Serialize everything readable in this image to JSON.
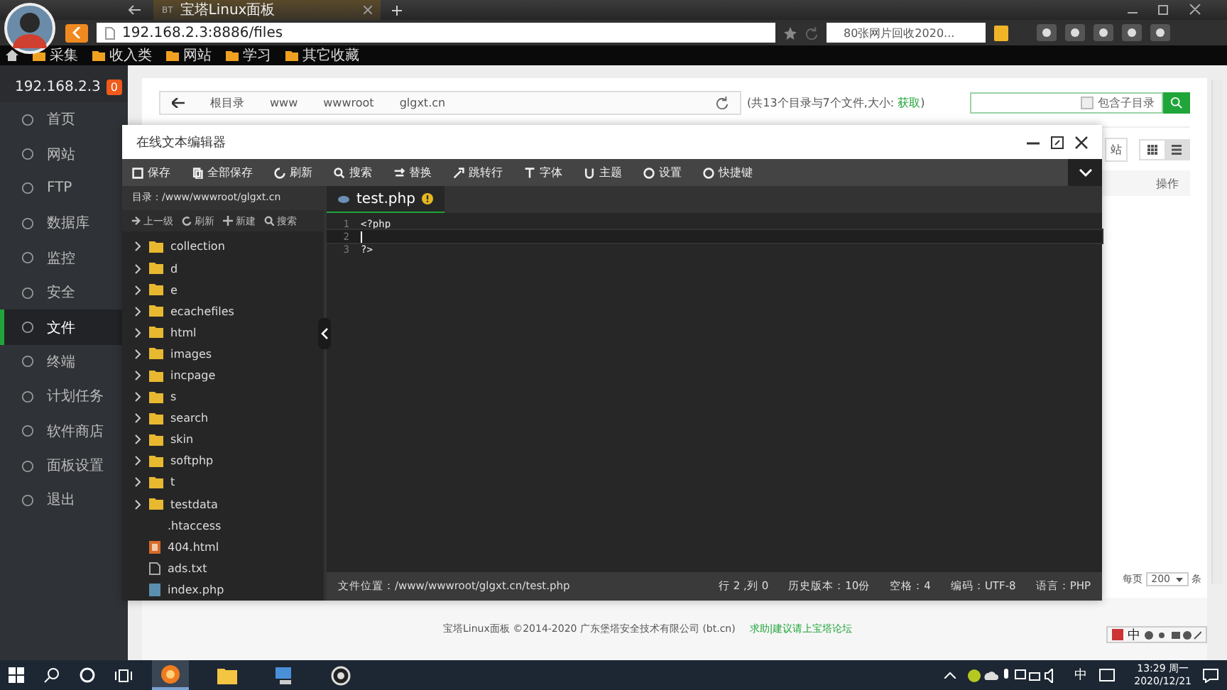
{
  "browser": {
    "tab": {
      "favicon": "BT",
      "title": "宝塔Linux面板"
    },
    "url": "192.168.2.3:8886/files",
    "search": "80张网片回收2020...",
    "bookmarks": [
      "采集",
      "收入类",
      "网站",
      "学习",
      "其它收藏"
    ]
  },
  "sidebar": {
    "host": "192.168.2.3",
    "badge": "0",
    "items": [
      {
        "label": "首页",
        "selected": false
      },
      {
        "label": "网站",
        "selected": false
      },
      {
        "label": "FTP",
        "selected": false
      },
      {
        "label": "数据库",
        "selected": false
      },
      {
        "label": "监控",
        "selected": false
      },
      {
        "label": "安全",
        "selected": false
      },
      {
        "label": "文件",
        "selected": true
      },
      {
        "label": "终端",
        "selected": false
      },
      {
        "label": "计划任务",
        "selected": false
      },
      {
        "label": "软件商店",
        "selected": false
      },
      {
        "label": "面板设置",
        "selected": false
      },
      {
        "label": "退出",
        "selected": false
      }
    ]
  },
  "files_page": {
    "breadcrumb": [
      "根目录",
      "www",
      "wwwroot",
      "glgxt.cn"
    ],
    "summary": "(共13个目录与7个文件,大小: ",
    "summary_link": "获取",
    "summary_end": ")",
    "search": {
      "subdir_label": "包含子目录",
      "subdir_checked": false
    },
    "partial_button": "站",
    "table": {
      "columns": [
        "操作"
      ]
    },
    "pagination": {
      "label": "每页",
      "per_page": "200",
      "unit": "条"
    }
  },
  "editor": {
    "title": "在线文本编辑器",
    "toolbar": [
      "保存",
      "全部保存",
      "刷新",
      "搜索",
      "替换",
      "跳转行",
      "字体",
      "主题",
      "设置",
      "快捷键"
    ],
    "directory": "目录：/www/wwwroot/glgxt.cn",
    "tree_actions": [
      "上一级",
      "刷新",
      "新建",
      "搜索"
    ],
    "tree": [
      {
        "name": "collection",
        "kind": "folder"
      },
      {
        "name": "d",
        "kind": "folder"
      },
      {
        "name": "e",
        "kind": "folder"
      },
      {
        "name": "ecachefiles",
        "kind": "folder"
      },
      {
        "name": "html",
        "kind": "folder"
      },
      {
        "name": "images",
        "kind": "folder"
      },
      {
        "name": "incpage",
        "kind": "folder"
      },
      {
        "name": "s",
        "kind": "folder"
      },
      {
        "name": "search",
        "kind": "folder"
      },
      {
        "name": "skin",
        "kind": "folder"
      },
      {
        "name": "softphp",
        "kind": "folder"
      },
      {
        "name": "t",
        "kind": "folder"
      },
      {
        "name": "testdata",
        "kind": "folder"
      },
      {
        "name": ".htaccess",
        "kind": "plain"
      },
      {
        "name": "404.html",
        "kind": "html"
      },
      {
        "name": "ads.txt",
        "kind": "text"
      },
      {
        "name": "index.php",
        "kind": "php"
      }
    ],
    "tabs": [
      {
        "label": "test.php",
        "selected": true,
        "modified": true
      }
    ],
    "lines": [
      {
        "number": "1",
        "text": "<?php",
        "active": false
      },
      {
        "number": "2",
        "active": true
      },
      {
        "number": "3",
        "text": "?>",
        "active": false
      }
    ],
    "status": {
      "path": "文件位置：/www/wwwroot/glgxt.cn/test.php",
      "position": "行 2 ,列 0",
      "history": "历史版本：10份",
      "spaces": "空格：4",
      "encoding": "编码：UTF-8",
      "language": "语言：PHP"
    }
  },
  "footer": {
    "copyright": "宝塔Linux面板 ©2014-2020 广东堡塔安全技术有限公司 (bt.cn)",
    "link": "求助|建议请上宝塔论坛"
  },
  "ime_bar": {
    "mode": "中"
  },
  "taskbar": {
    "ime": "中",
    "time": "13:29 周一",
    "date": "2020/12/21"
  }
}
